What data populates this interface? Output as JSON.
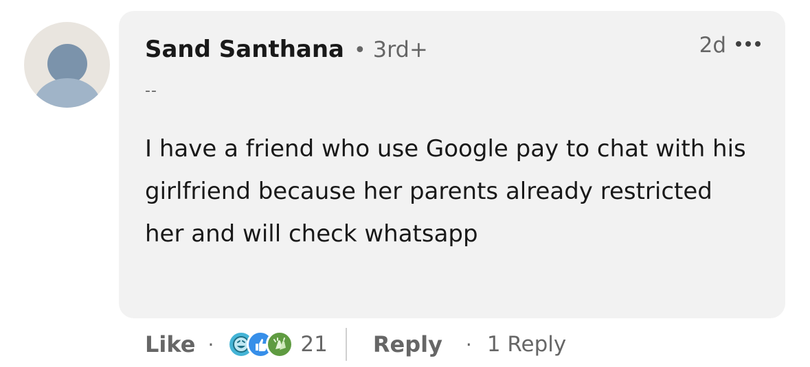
{
  "comment": {
    "author": "Sand Santhana",
    "separator_dot": "•",
    "degree": "3rd+",
    "headline": "--",
    "time": "2d",
    "more_icon": "more-horizontal-icon",
    "text": "I have a friend who use Google pay to chat with his girlfriend because her parents already restricted her and will check whatsapp"
  },
  "actions": {
    "like_label": "Like",
    "dot1": "·",
    "reactions": [
      "funny-reaction-icon",
      "like-reaction-icon",
      "celebrate-reaction-icon"
    ],
    "reaction_count": "21",
    "reply_label": "Reply",
    "dot2": "·",
    "replies_label": "1 Reply"
  },
  "colors": {
    "bubble": "#f2f2f2",
    "secondary_text": "#666666",
    "funny": "#44b4d6",
    "like": "#378fe9",
    "celebrate": "#5f9b41"
  }
}
